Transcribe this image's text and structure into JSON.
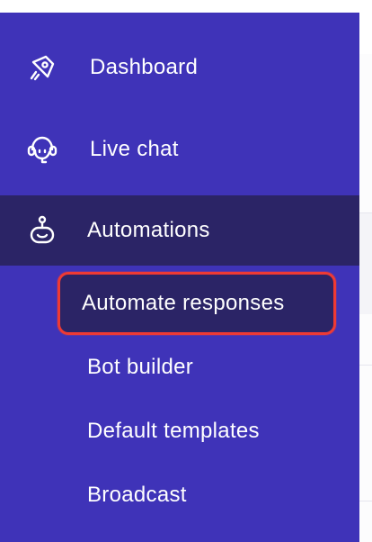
{
  "sidebar": {
    "items": [
      {
        "label": "Dashboard",
        "icon": "rocket-icon"
      },
      {
        "label": "Live chat",
        "icon": "headset-icon"
      },
      {
        "label": "Automations",
        "icon": "bot-icon"
      }
    ],
    "submenu": [
      {
        "label": "Automate responses"
      },
      {
        "label": "Bot builder"
      },
      {
        "label": "Default templates"
      },
      {
        "label": "Broadcast"
      }
    ]
  },
  "colors": {
    "sidebar_bg": "#3f33b8",
    "active_bg": "#2b2466",
    "highlight_border": "#ee3a34",
    "text": "#ffffff"
  }
}
